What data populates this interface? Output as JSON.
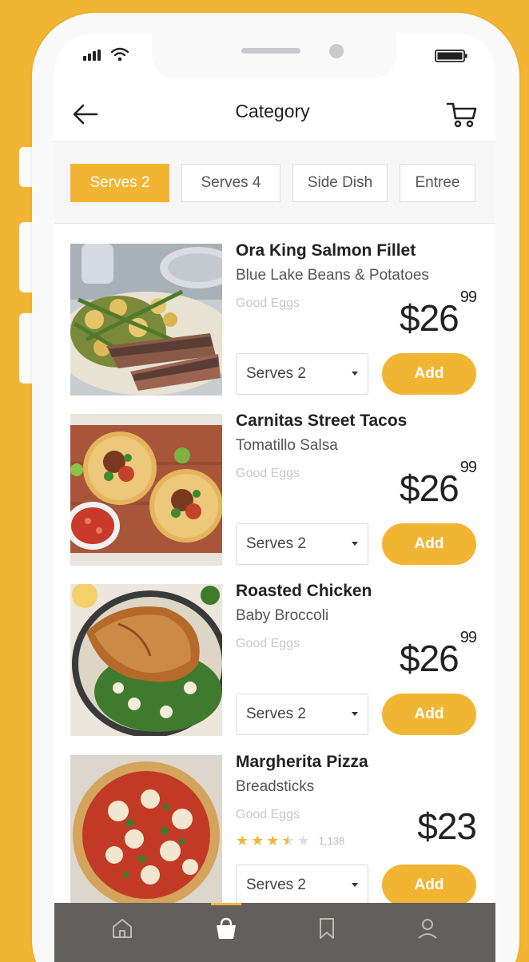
{
  "header": {
    "title": "Category",
    "back_icon": "arrow-left-icon",
    "cart_icon": "cart-icon"
  },
  "tabs": [
    {
      "label": "Serves 2",
      "active": true
    },
    {
      "label": "Serves 4",
      "active": false
    },
    {
      "label": "Side Dish",
      "active": false
    },
    {
      "label": "Entree",
      "active": false
    }
  ],
  "items": [
    {
      "name": "Ora King Salmon Fillet",
      "subtitle": "Blue Lake Beans & Potatoes",
      "vendor": "Good Eggs",
      "price_whole": "$26",
      "price_cents": "99",
      "serves": "Serves 2",
      "add_label": "Add"
    },
    {
      "name": "Carnitas Street Tacos",
      "subtitle": "Tomatillo Salsa",
      "vendor": "Good Eggs",
      "price_whole": "$26",
      "price_cents": "99",
      "serves": "Serves 2",
      "add_label": "Add"
    },
    {
      "name": "Roasted Chicken",
      "subtitle": "Baby Broccoli",
      "vendor": "Good Eggs",
      "price_whole": "$26",
      "price_cents": "99",
      "serves": "Serves 2",
      "add_label": "Add"
    },
    {
      "name": "Margherita Pizza",
      "subtitle": "Breadsticks",
      "vendor": "Good Eggs",
      "price_whole": "$23",
      "price_cents": "",
      "serves": "Serves 2",
      "add_label": "Add",
      "rating": 3.5,
      "rating_max": 5,
      "rating_count": "1,138"
    }
  ],
  "bottom_nav": [
    {
      "icon": "home-icon",
      "active": false
    },
    {
      "icon": "shopping-bag-icon",
      "active": true
    },
    {
      "icon": "bookmark-icon",
      "active": false
    },
    {
      "icon": "user-icon",
      "active": false
    }
  ],
  "colors": {
    "accent": "#F2B533",
    "background": "#F2B533",
    "nav_bar": "#625f5c",
    "text_dark": "#222222",
    "muted": "#c8c8c8"
  }
}
